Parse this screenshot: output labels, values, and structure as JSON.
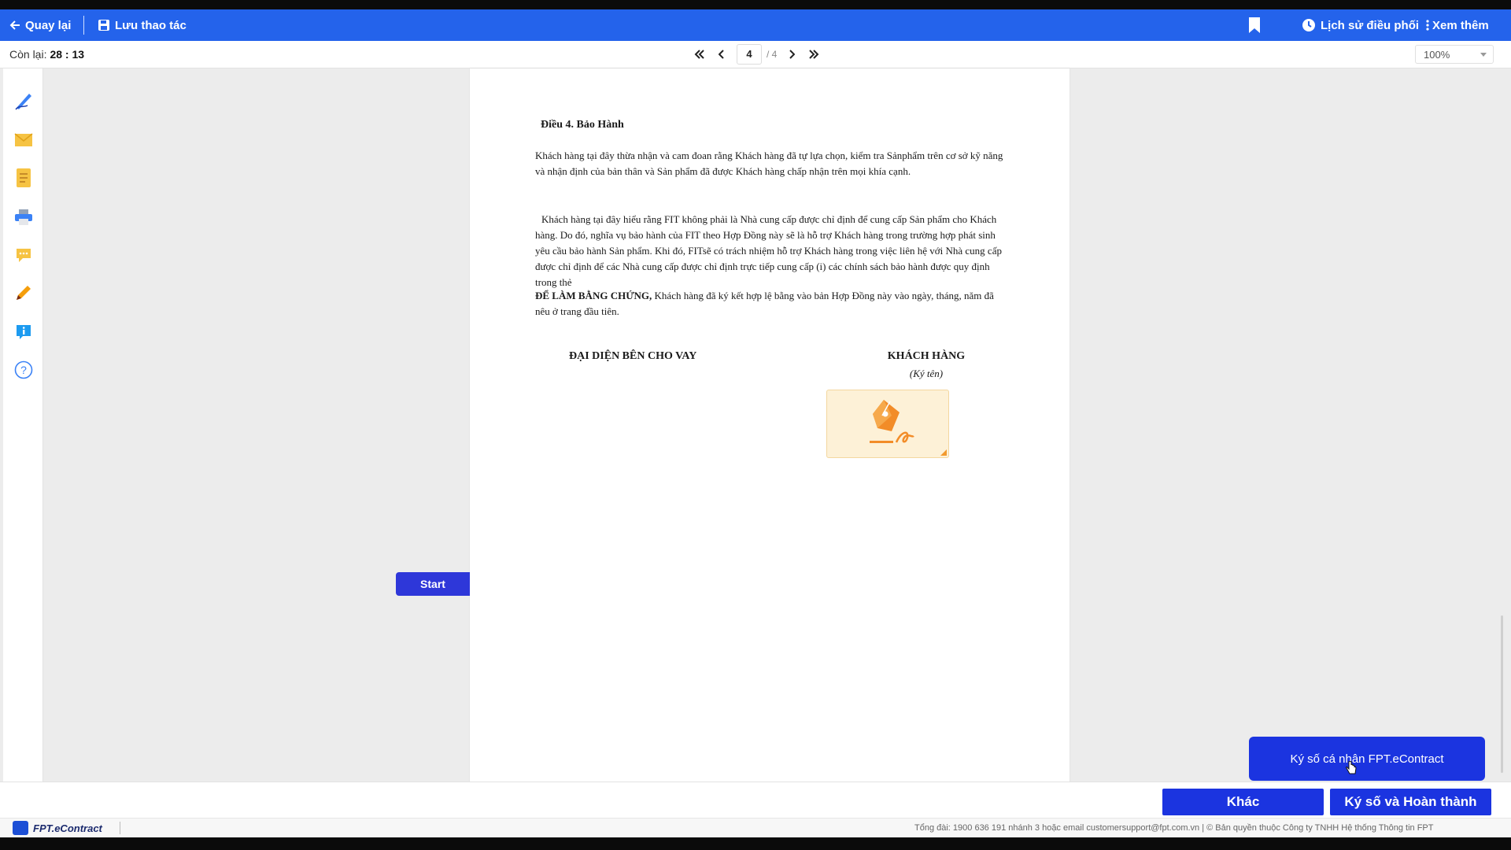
{
  "topbar": {
    "back_label": "Quay lại",
    "save_label": "Lưu thao tác",
    "history_label": "Lịch sử điều phối",
    "more_label": "Xem thêm",
    "accent_color": "#2463eb"
  },
  "subbar": {
    "remain_label": "Còn lại:",
    "remain_time": "28 : 13",
    "current_page": "4",
    "total_pages": "/ 4",
    "zoom": "100%"
  },
  "sidebar": {
    "icons": [
      "signature-pen-icon",
      "envelope-icon",
      "note-icon",
      "printer-icon",
      "comment-icon",
      "pencil-icon",
      "info-icon",
      "help-icon"
    ]
  },
  "document": {
    "heading": "Điều 4. Bảo Hành",
    "para1": "Khách hàng tại đây thừa nhận và cam đoan rằng Khách hàng đã tự lựa chọn, kiểm tra Sảnphẩm trên cơ sở kỹ năng và nhận định của bản thân và Sản phẩm đã được Khách hàng chấp nhận trên mọi khía cạnh.",
    "para2": "Khách hàng tại đây hiểu rằng FIT không phải là Nhà cung cấp được chỉ định để cung cấp Sản phẩm cho Khách hàng. Do đó, nghĩa vụ bảo hành của FIT theo Hợp Đồng này sẽ là hỗ trợ Khách hàng trong trường hợp phát sinh yêu cầu bảo hành Sản phẩm. Khi đó, FITsẽ có trách nhiệm hỗ trợ Khách hàng trong việc liên hệ với Nhà cung cấp được chỉ định để các Nhà cung cấp được chỉ định trực tiếp cung cấp (i) các chính sách bảo hành được quy định trong thẻ",
    "para3_bold": "ĐỂ LÀM BẰNG CHỨNG,",
    "para3_rest": " Khách hàng đã ký kết hợp lệ bằng vào bản Hợp Đồng này vào ngày, tháng, năm đã nêu ở trang đầu tiên.",
    "sig_left_title": "ĐẠI DIỆN BÊN CHO VAY",
    "sig_right_title": "KHÁCH HÀNG",
    "sig_right_sub": "(Ký tên)"
  },
  "start_label": "Start",
  "popup_label": "Ký số cá nhân FPT.eContract",
  "buttons": {
    "other": "Khác",
    "sign_complete": "Ký số và Hoàn thành",
    "button_color": "#1b34e0"
  },
  "footer": {
    "brand": "FPT.eContract",
    "text": "Tổng đài: 1900 636 191 nhánh 3 hoặc email customersupport@fpt.com.vn | © Bản quyền thuộc Công ty TNHH Hệ thống Thông tin FPT"
  }
}
